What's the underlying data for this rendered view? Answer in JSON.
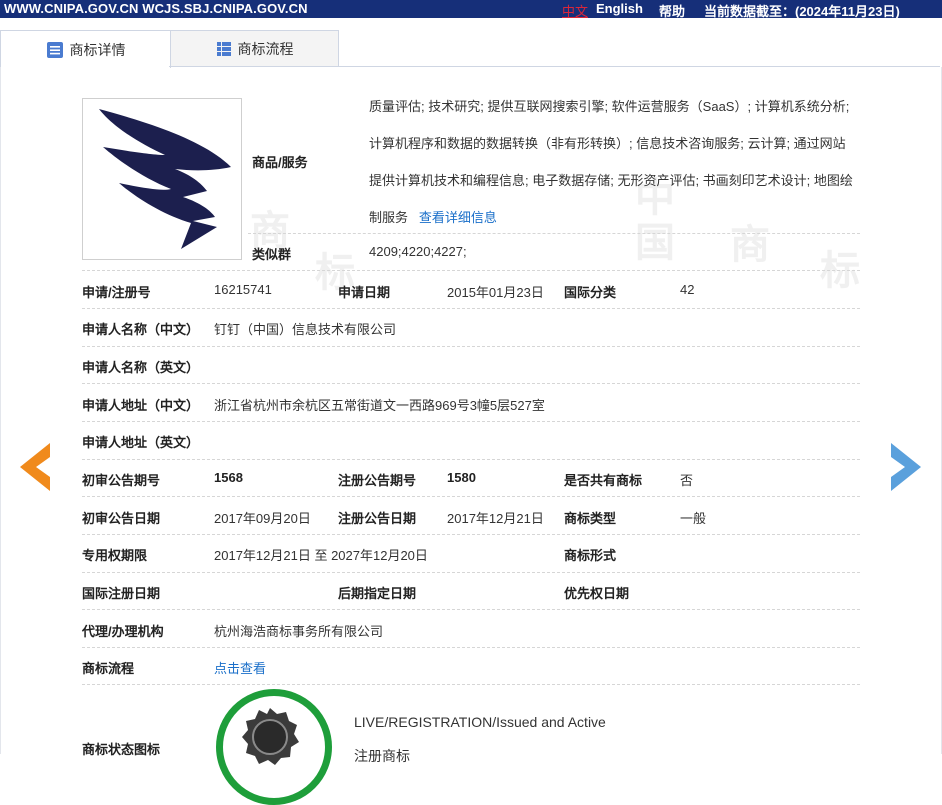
{
  "topbar": {
    "site_links": "WWW.CNIPA.GOV.CN WCJS.SBJ.CNIPA.GOV.CN",
    "lang_cn": "中文",
    "lang_en": "English",
    "help": "帮助",
    "data_date": "当前数据截至：(2024年11月23日)"
  },
  "tabs": [
    {
      "label": "商标详情",
      "icon": "list-detail-icon",
      "active": true
    },
    {
      "label": "商标流程",
      "icon": "grid-icon",
      "active": false
    }
  ],
  "watermark": [
    "商",
    "标",
    "中",
    "国",
    "商",
    "标"
  ],
  "detail": {
    "goods_label": "商品/服务",
    "goods_lines": [
      "质量评估; 技术研究; 提供互联网搜索引擎; 软件运营服务（SaaS）; 计算机系统分析;",
      "计算机程序和数据的数据转换（非有形转换）; 信息技术咨询服务; 云计算; 通过网站",
      "提供计算机技术和编程信息; 电子数据存储; 无形资产评估; 书画刻印艺术设计; 地图绘",
      "制服务"
    ],
    "goods_more_link": "查看详细信息",
    "similar_group_label": "类似群",
    "similar_group_value": "4209;4220;4227;",
    "reg_no_label": "申请/注册号",
    "reg_no": "16215741",
    "apply_date_label": "申请日期",
    "apply_date": "2015年01月23日",
    "intl_class_label": "国际分类",
    "intl_class": "42",
    "applicant_cn_label": "申请人名称（中文）",
    "applicant_cn": "钉钉（中国）信息技术有限公司",
    "applicant_en_label": "申请人名称（英文）",
    "applicant_en": "",
    "address_cn_label": "申请人地址（中文）",
    "address_cn": "浙江省杭州市余杭区五常街道文一西路969号3幢5层527室",
    "address_en_label": "申请人地址（英文）",
    "address_en": "",
    "prelim_issue_label": "初审公告期号",
    "prelim_issue": "1568",
    "reg_issue_label": "注册公告期号",
    "reg_issue": "1580",
    "shared_label": "是否共有商标",
    "shared": "否",
    "prelim_date_label": "初审公告日期",
    "prelim_date": "2017年09月20日",
    "reg_date_label": "注册公告日期",
    "reg_date": "2017年12月21日",
    "mark_type_label": "商标类型",
    "mark_type": "一般",
    "exclusive_label": "专用权期限",
    "exclusive": "2017年12月21日 至 2027年12月20日",
    "mark_form_label": "商标形式",
    "mark_form": "",
    "intl_reg_date_label": "国际注册日期",
    "intl_reg_date": "",
    "later_designation_label": "后期指定日期",
    "later_designation": "",
    "priority_date_label": "优先权日期",
    "priority_date": "",
    "agency_label": "代理/办理机构",
    "agency": "杭州海浩商标事务所有限公司",
    "flow_label": "商标流程",
    "flow_link": "点击查看",
    "status_icon_label": "商标状态图标",
    "status_text": "LIVE/REGISTRATION/Issued and Active",
    "status_cn": "注册商标"
  },
  "colors": {
    "topbar": "#162f79",
    "link": "#1a6fc9",
    "prev_arrow": "#f08a1c",
    "next_arrow": "#5aa0dc",
    "status_ring": "#1e9e3a"
  },
  "nav": {
    "prev": "prev-arrow-icon",
    "next": "next-arrow-icon"
  }
}
